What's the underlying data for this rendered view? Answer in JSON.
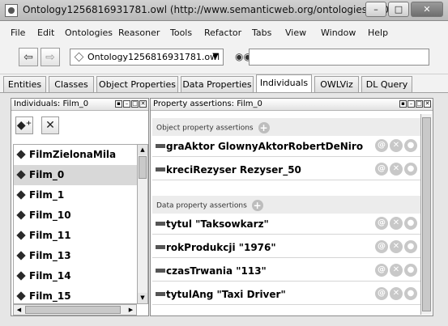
{
  "window": {
    "title": "Ontology1256816931781.owl (http://www.semanticweb.org/ontologies/2009...",
    "minimize": "–",
    "maximize": "□",
    "close": "✕"
  },
  "menu": [
    "File",
    "Edit",
    "Ontologies",
    "Reasoner",
    "Tools",
    "Refactor",
    "Tabs",
    "View",
    "Window",
    "Help"
  ],
  "toolbar": {
    "back": "⇦",
    "forward": "⇨",
    "ontology_selector": "Ontology1256816931781.owl",
    "search_value": ""
  },
  "tabs": [
    "Entities",
    "Classes",
    "Object Properties",
    "Data Properties",
    "Individuals",
    "OWLViz",
    "DL Query"
  ],
  "active_tab": "Individuals",
  "individuals_panel": {
    "title": "Individuals: Film_0",
    "items": [
      "FilmZielonaMila",
      "Film_0",
      "Film_1",
      "Film_10",
      "Film_11",
      "Film_13",
      "Film_14",
      "Film_15"
    ],
    "selected": "Film_0"
  },
  "assertions_panel": {
    "title": "Property assertions: Film_0",
    "object_header": "Object property assertions",
    "object_assertions": [
      "graAktor  GlownyAktorRobertDeNiro",
      "kreciRezyser  Rezyser_50"
    ],
    "data_header": "Data property assertions",
    "data_assertions": [
      "tytul  \"Taksowkarz\"",
      "rokProdukcji  \"1976\"",
      "czasTrwania  \"113\"",
      "tytulAng  \"Taxi Driver\""
    ]
  }
}
